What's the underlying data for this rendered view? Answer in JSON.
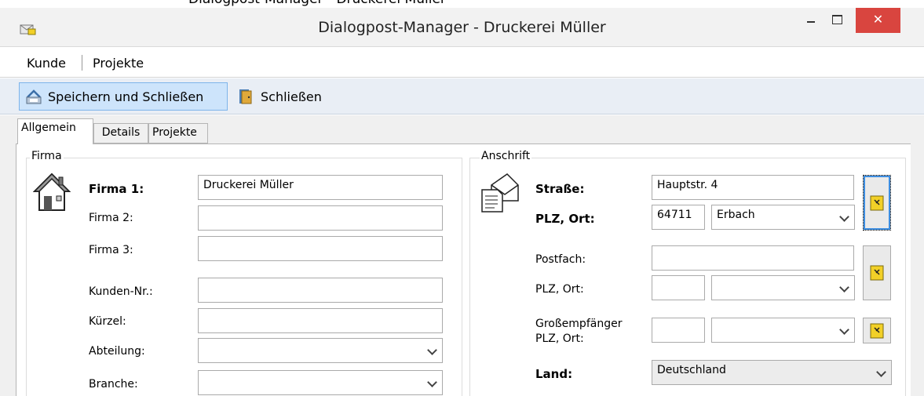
{
  "window": {
    "top_strip_text": "Dialogpost-Manager - Druckerei Müller",
    "title": "Dialogpost-Manager - Druckerei Müller",
    "close_glyph": "✕"
  },
  "menu": {
    "items": [
      {
        "label": "Kunde"
      },
      {
        "label": "Projekte"
      }
    ]
  },
  "toolbar": {
    "save_close_label": "Speichern und Schließen",
    "close_label": "Schließen"
  },
  "tabs": [
    {
      "label": "Allgemein",
      "active": true
    },
    {
      "label": "Details",
      "active": false
    },
    {
      "label": "Projekte",
      "active": false
    }
  ],
  "firma": {
    "group_label": "Firma",
    "icon": "house-icon",
    "fields": [
      {
        "label": "Firma 1:",
        "value": "Druckerei Müller",
        "bold": true
      },
      {
        "label": "Firma 2:",
        "value": ""
      },
      {
        "label": "Firma 3:",
        "value": ""
      },
      {
        "label": "Kunden-Nr.:",
        "value": ""
      },
      {
        "label": "Kürzel:",
        "value": ""
      },
      {
        "label": "Abteilung:",
        "value": ""
      },
      {
        "label": "Branche:",
        "value": ""
      }
    ]
  },
  "anschrift": {
    "group_label": "Anschrift",
    "icon": "letter-icon",
    "strasse_label": "Straße:",
    "strasse_value": "Hauptstr. 4",
    "plz_ort_label": "PLZ, Ort:",
    "plz_value": "64711",
    "ort_value": "Erbach",
    "postfach_label": "Postfach:",
    "postfach_value": "",
    "postfach_plz_ort_label": "PLZ, Ort:",
    "postfach_plz_value": "",
    "postfach_ort_value": "",
    "gross_label_line1": "Großempfänger",
    "gross_label_line2": "PLZ, Ort:",
    "gross_plz_value": "",
    "gross_ort_value": "",
    "land_label": "Land:",
    "land_value": "Deutschland"
  },
  "colors": {
    "close_button": "#d9453f",
    "toolbar_bg": "#e9eef5",
    "save_button_bg": "#cde4fb",
    "book_yellow": "#f2d027"
  }
}
